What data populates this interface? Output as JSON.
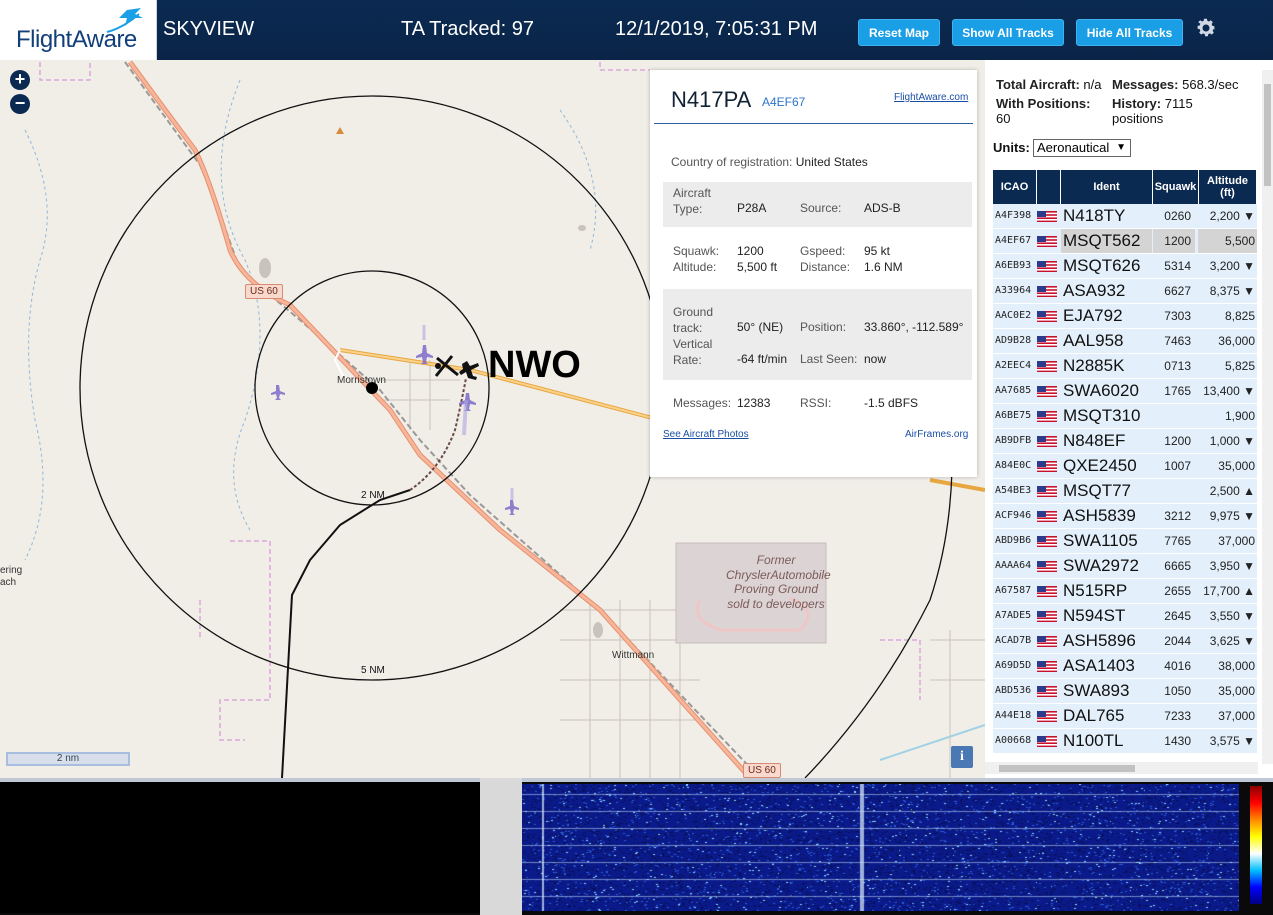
{
  "header": {
    "logo": "FlightAware",
    "app_name": "SKYVIEW",
    "tracked": "TA Tracked: 97",
    "datetime": "12/1/2019, 7:05:31 PM",
    "buttons": {
      "reset_map": "Reset Map",
      "show_all_tracks": "Show All Tracks",
      "hide_all_tracks": "Hide All Tracks"
    },
    "settings_icon": "gear-icon"
  },
  "map": {
    "zoom_in": "+",
    "zoom_out": "−",
    "route_label": "NWO",
    "town_labels": [
      "Morristown",
      "Wittmann",
      "ering",
      "ach"
    ],
    "ring_labels": [
      "2 NM",
      "5 NM"
    ],
    "road_shields": [
      "US 60",
      "US 60"
    ],
    "proving_ground": "Former ChryslerAutomobile Proving Ground sold to developers",
    "scale": "2 nm",
    "info": "i"
  },
  "popup": {
    "callsign": "N417PA",
    "hex": "A4EF67",
    "flightaware_link": "FlightAware.com",
    "country_label": "Country of registration:",
    "country_value": "United States",
    "aircraft_type_label": "Aircraft Type:",
    "aircraft_type_value": "P28A",
    "source_label": "Source:",
    "source_value": "ADS-B",
    "squawk_label": "Squawk:",
    "squawk_value": "1200",
    "gspeed_label": "Gspeed:",
    "gspeed_value": "95 kt",
    "altitude_label": "Altitude:",
    "altitude_value": "5,500 ft",
    "distance_label": "Distance:",
    "distance_value": "1.6 NM",
    "ground_track_label": "Ground track:",
    "ground_track_value": "50° (NE)",
    "position_label": "Position:",
    "position_value": "33.860°, -112.589°",
    "vertical_rate_label": "Vertical Rate:",
    "vertical_rate_value": "-64 ft/min",
    "last_seen_label": "Last Seen:",
    "last_seen_value": "now",
    "messages_label": "Messages:",
    "messages_value": "12383",
    "rssi_label": "RSSI:",
    "rssi_value": "-1.5 dBFS",
    "photos_link": "See Aircraft Photos",
    "airframes_link": "AirFrames.org"
  },
  "sidebar": {
    "total_aircraft_label": "Total Aircraft:",
    "total_aircraft_value": "n/a",
    "messages_label": "Messages:",
    "messages_value": "568.3/sec",
    "with_positions_label": "With Positions:",
    "with_positions_value": "60",
    "history_label": "History:",
    "history_value": "7115 positions",
    "units_label": "Units:",
    "units_value": "Aeronautical",
    "columns": [
      "ICAO",
      "",
      "Ident",
      "Squawk",
      "Altitude (ft)"
    ],
    "rows": [
      {
        "icao": "A4F398",
        "ident": "N418TY",
        "squawk": "0260",
        "altitude": "2,200 ▼"
      },
      {
        "icao": "A4EF67",
        "ident": "MSQT562",
        "squawk": "1200",
        "altitude": "5,500",
        "selected": true
      },
      {
        "icao": "A6EB93",
        "ident": "MSQT626",
        "squawk": "5314",
        "altitude": "3,200 ▼"
      },
      {
        "icao": "A33964",
        "ident": "ASA932",
        "squawk": "6627",
        "altitude": "8,375 ▼"
      },
      {
        "icao": "AAC0E2",
        "ident": "EJA792",
        "squawk": "7303",
        "altitude": "8,825"
      },
      {
        "icao": "AD9B28",
        "ident": "AAL958",
        "squawk": "7463",
        "altitude": "36,000"
      },
      {
        "icao": "A2EEC4",
        "ident": "N2885K",
        "squawk": "0713",
        "altitude": "5,825"
      },
      {
        "icao": "AA7685",
        "ident": "SWA6020",
        "squawk": "1765",
        "altitude": "13,400 ▼"
      },
      {
        "icao": "A6BE75",
        "ident": "MSQT310",
        "squawk": "",
        "altitude": "1,900"
      },
      {
        "icao": "AB9DFB",
        "ident": "N848EF",
        "squawk": "1200",
        "altitude": "1,000 ▼"
      },
      {
        "icao": "A84E0C",
        "ident": "QXE2450",
        "squawk": "1007",
        "altitude": "35,000"
      },
      {
        "icao": "A54BE3",
        "ident": "MSQT77",
        "squawk": "",
        "altitude": "2,500 ▲"
      },
      {
        "icao": "ACF946",
        "ident": "ASH5839",
        "squawk": "3212",
        "altitude": "9,975 ▼"
      },
      {
        "icao": "ABD9B6",
        "ident": "SWA1105",
        "squawk": "7765",
        "altitude": "37,000"
      },
      {
        "icao": "AAAA64",
        "ident": "SWA2972",
        "squawk": "6665",
        "altitude": "3,950 ▼"
      },
      {
        "icao": "A67587",
        "ident": "N515RP",
        "squawk": "2655",
        "altitude": "17,700 ▲"
      },
      {
        "icao": "A7ADE5",
        "ident": "N594ST",
        "squawk": "2645",
        "altitude": "3,550 ▼"
      },
      {
        "icao": "ACAD7B",
        "ident": "ASH5896",
        "squawk": "2044",
        "altitude": "3,625 ▼"
      },
      {
        "icao": "A69D5D",
        "ident": "ASA1403",
        "squawk": "4016",
        "altitude": "38,000"
      },
      {
        "icao": "ABD536",
        "ident": "SWA893",
        "squawk": "1050",
        "altitude": "35,000"
      },
      {
        "icao": "A44E18",
        "ident": "DAL765",
        "squawk": "7233",
        "altitude": "37,000"
      },
      {
        "icao": "A00668",
        "ident": "N100TL",
        "squawk": "1430",
        "altitude": "3,575 ▼"
      }
    ]
  },
  "colors": {
    "header_bg": "#0b2a52",
    "button_bg": "#1a9ee6",
    "row_bg": "#e3effa",
    "selected_row_bg": "#d4d4d4"
  }
}
